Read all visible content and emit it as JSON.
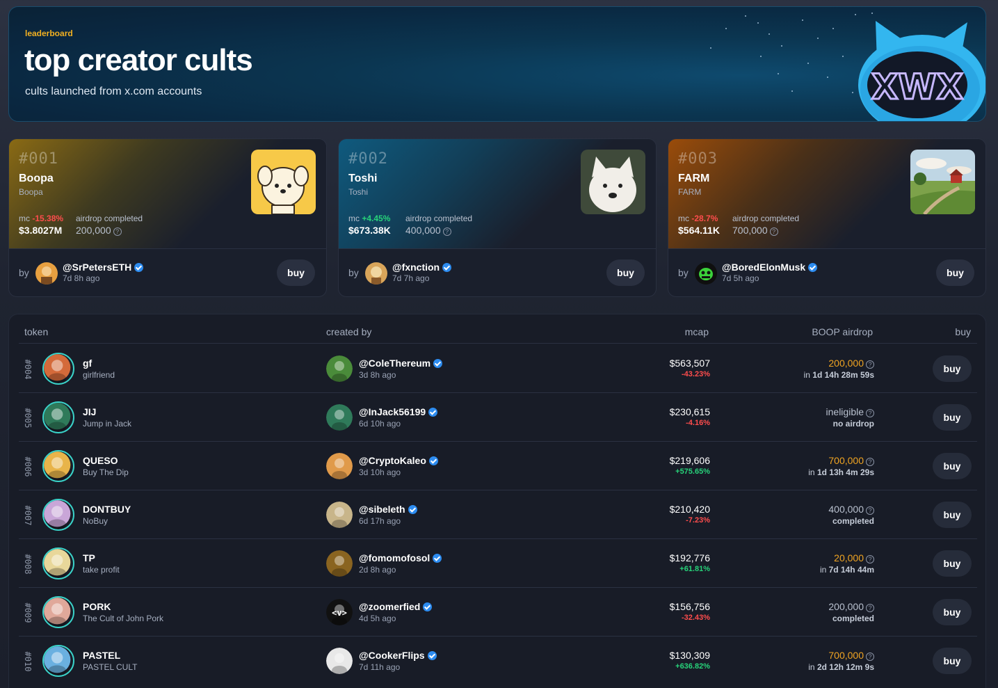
{
  "hero": {
    "eyebrow": "leaderboard",
    "title": "top creator cults",
    "subtitle": "cults launched from x.com accounts"
  },
  "featured": [
    {
      "rank": "#001",
      "name": "Boopa",
      "ticker": "Boopa",
      "mc_label": "mc",
      "mc_change": "-15.38%",
      "mc_value": "$3.8027M",
      "airdrop_label": "airdrop completed",
      "airdrop_value": "200,000",
      "by_label": "by",
      "handle": "@SrPetersETH",
      "ago": "7d 8h ago",
      "buy_label": "buy",
      "gradient_color": "#8a6a14",
      "thumb_icon": "puppy-icon"
    },
    {
      "rank": "#002",
      "name": "Toshi",
      "ticker": "Toshi",
      "mc_label": "mc",
      "mc_change": "+4.45%",
      "mc_value": "$673.38K",
      "airdrop_label": "airdrop completed",
      "airdrop_value": "400,000",
      "by_label": "by",
      "handle": "@fxnction",
      "ago": "7d 7h ago",
      "buy_label": "buy",
      "gradient_color": "#0f5a7e",
      "thumb_icon": "white-dog-icon"
    },
    {
      "rank": "#003",
      "name": "FARM",
      "ticker": "FARM",
      "mc_label": "mc",
      "mc_change": "-28.7%",
      "mc_value": "$564.11K",
      "airdrop_label": "airdrop completed",
      "airdrop_value": "700,000",
      "by_label": "by",
      "handle": "@BoredElonMusk",
      "ago": "7d 5h ago",
      "buy_label": "buy",
      "gradient_color": "#9a4c0a",
      "thumb_icon": "farm-landscape-icon"
    }
  ],
  "table": {
    "headers": {
      "token": "token",
      "created_by": "created by",
      "mcap": "mcap",
      "airdrop": "BOOP airdrop",
      "buy": "buy"
    },
    "rows": [
      {
        "rank": "#004",
        "name": "gf",
        "sub": "girlfriend",
        "handle": "@ColeThereum",
        "ago": "3d 8h ago",
        "mcap": "$563,507",
        "change": "-43.23%",
        "airdrop": "200,000",
        "airdrop_sub_prefix": "in",
        "airdrop_sub": "1d 14h 28m 59s",
        "airdrop_state": "active",
        "buy": "buy",
        "avatar_color": "#d46a3a",
        "creator_color": "#4a8b3a"
      },
      {
        "rank": "#005",
        "name": "JIJ",
        "sub": "Jump in Jack",
        "handle": "@InJack56199",
        "ago": "6d 10h ago",
        "mcap": "$230,615",
        "change": "-4.16%",
        "airdrop": "ineligible",
        "airdrop_sub_prefix": "",
        "airdrop_sub": "no airdrop",
        "airdrop_state": "none",
        "buy": "buy",
        "avatar_color": "#2f7a5a",
        "creator_color": "#2f7a5a"
      },
      {
        "rank": "#006",
        "name": "QUESO",
        "sub": "Buy The Dip",
        "handle": "@CryptoKaleo",
        "ago": "3d 10h ago",
        "mcap": "$219,606",
        "change": "+575.65%",
        "airdrop": "700,000",
        "airdrop_sub_prefix": "in",
        "airdrop_sub": "1d 13h 4m 29s",
        "airdrop_state": "active",
        "buy": "buy",
        "avatar_color": "#e8b44a",
        "creator_color": "#e09a4a"
      },
      {
        "rank": "#007",
        "name": "DONTBUY",
        "sub": "NoBuy",
        "handle": "@sibeleth",
        "ago": "6d 17h ago",
        "mcap": "$210,420",
        "change": "-7.23%",
        "airdrop": "400,000",
        "airdrop_sub_prefix": "",
        "airdrop_sub": "completed",
        "airdrop_state": "done",
        "buy": "buy",
        "avatar_color": "#c9a6d8",
        "creator_color": "#c8b58a"
      },
      {
        "rank": "#008",
        "name": "TP",
        "sub": "take profit",
        "handle": "@fomomofosol",
        "ago": "2d 8h ago",
        "mcap": "$192,776",
        "change": "+61.81%",
        "airdrop": "20,000",
        "airdrop_sub_prefix": "in",
        "airdrop_sub": "7d 14h 44m",
        "airdrop_state": "active",
        "buy": "buy",
        "avatar_color": "#e8d79a",
        "creator_color": "#8a6420"
      },
      {
        "rank": "#009",
        "name": "PORK",
        "sub": "The Cult of John Pork",
        "handle": "@zoomerfied",
        "ago": "4d 5h ago",
        "mcap": "$156,756",
        "change": "-32.43%",
        "airdrop": "200,000",
        "airdrop_sub_prefix": "",
        "airdrop_sub": "completed",
        "airdrop_state": "done",
        "buy": "buy",
        "avatar_color": "#e0a89a",
        "creator_color": "#111111",
        "creator_text": "<v>"
      },
      {
        "rank": "#010",
        "name": "PASTEL",
        "sub": "PASTEL CULT",
        "handle": "@CookerFlips",
        "ago": "7d 11h ago",
        "mcap": "$130,309",
        "change": "+636.82%",
        "airdrop": "700,000",
        "airdrop_sub_prefix": "in",
        "airdrop_sub": "2d 12h 12m 9s",
        "airdrop_state": "active",
        "buy": "buy",
        "avatar_color": "#6ab0e0",
        "creator_color": "#e8e8e8"
      }
    ]
  },
  "colors": {
    "accent": "#f2b021",
    "positive": "#27d37a",
    "negative": "#ff4d4d",
    "airdrop_active": "#f0a422",
    "verified": "#2d8cf0"
  }
}
